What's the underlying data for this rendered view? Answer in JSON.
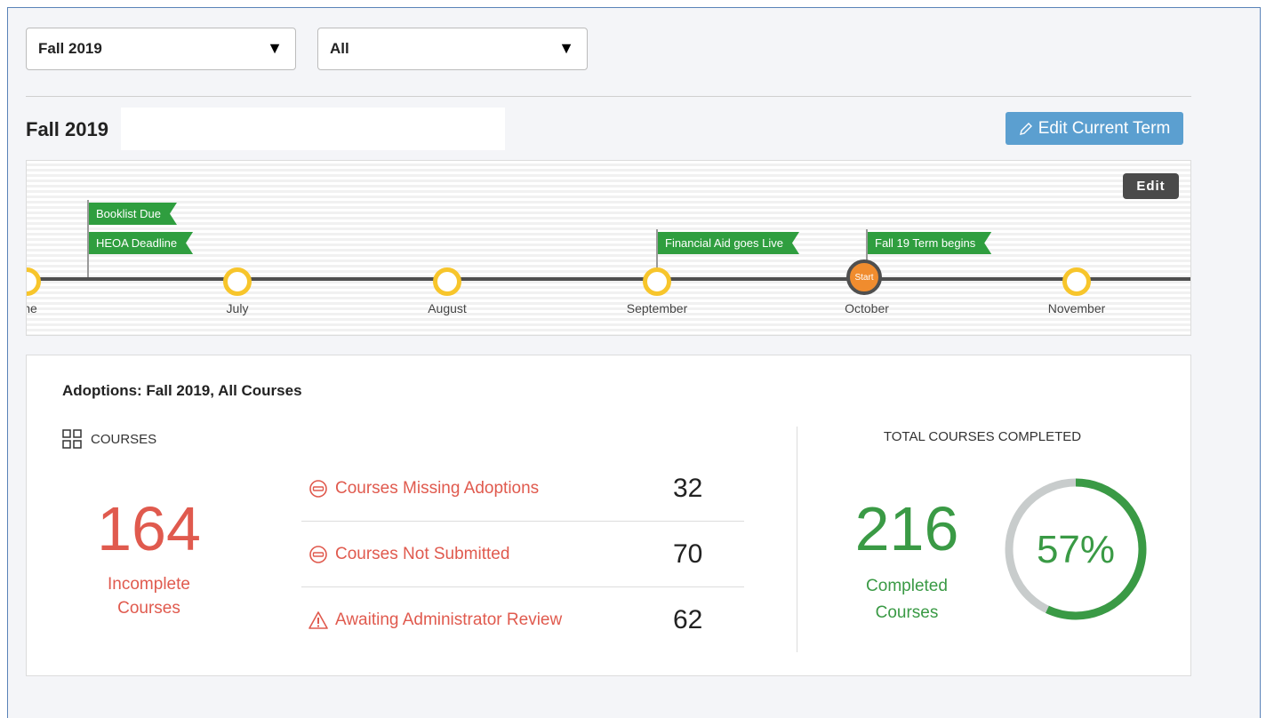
{
  "filters": {
    "term": "Fall 2019",
    "scope": "All"
  },
  "term_header": {
    "title": "Fall 2019",
    "edit_button": "Edit Current Term"
  },
  "timeline": {
    "edit_label": "Edit",
    "months": [
      "ne",
      "July",
      "August",
      "September",
      "October",
      "November"
    ],
    "flags": [
      "Booklist Due",
      "HEOA Deadline",
      "Financial Aid goes Live",
      "Fall 19 Term begins"
    ],
    "start_label": "Start",
    "colors": {
      "flag": "#2f9e3f",
      "node": "#f7c52b",
      "start": "#f08c2e"
    }
  },
  "adoptions": {
    "title": "Adoptions: Fall 2019, All Courses",
    "courses_label": "COURSES",
    "incomplete_count": "164",
    "incomplete_label_1": "Incomplete",
    "incomplete_label_2": "Courses",
    "rows": [
      {
        "label": "Courses Missing Adoptions",
        "value": "32",
        "icon": "minus-circle-icon"
      },
      {
        "label": "Courses Not Submitted",
        "value": "70",
        "icon": "minus-circle-icon"
      },
      {
        "label": "Awaiting Administrator Review",
        "value": "62",
        "icon": "warning-icon"
      }
    ],
    "total_label": "TOTAL COURSES COMPLETED",
    "completed_count": "216",
    "completed_label_1": "Completed",
    "completed_label_2": "Courses",
    "percent_text": "57%",
    "percent_value": 57,
    "colors": {
      "red": "#e05a4e",
      "green": "#3a9a45",
      "ring_bg": "#c8cccc"
    }
  }
}
